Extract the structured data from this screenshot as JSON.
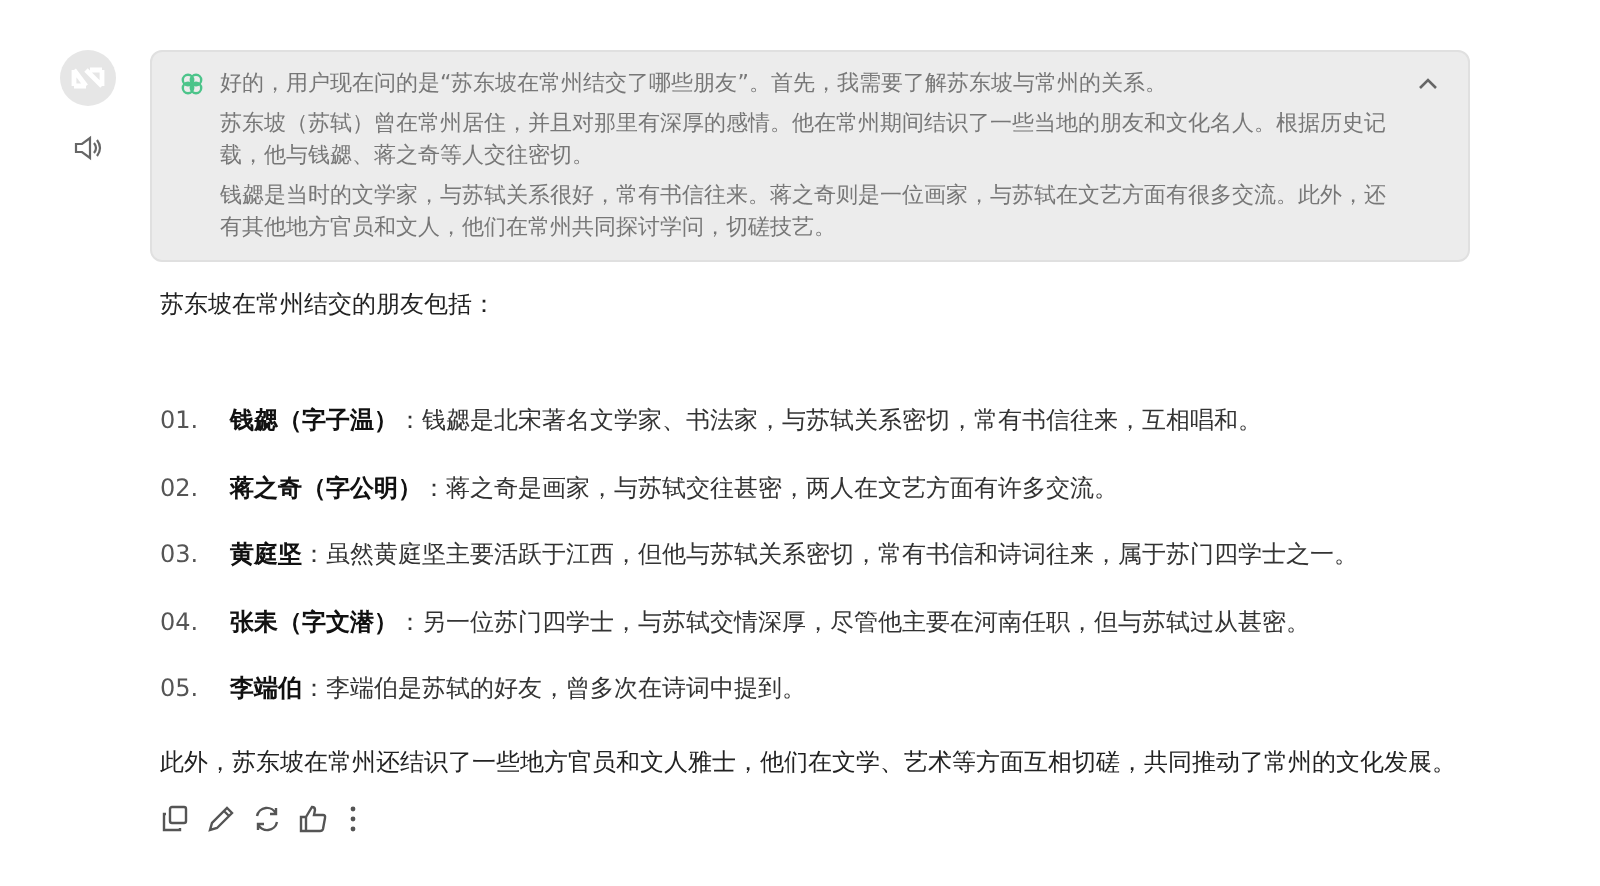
{
  "thinking": {
    "expanded": true,
    "paragraphs": [
      "好的，用户现在问的是“苏东坡在常州结交了哪些朋友”。首先，我需要了解苏东坡与常州的关系。",
      "苏东坡（苏轼）曾在常州居住，并且对那里有深厚的感情。他在常州期间结识了一些当地的朋友和文化名人。根据历史记载，他与钱勰、蒋之奇等人交往密切。",
      "钱勰是当时的文学家，与苏轼关系很好，常有书信往来。蒋之奇则是一位画家，与苏轼在文艺方面有很多交流。此外，还有其他地方官员和文人，他们在常州共同探讨学问，切磋技艺。"
    ]
  },
  "intro": "苏东坡在常州结交的朋友包括：",
  "friends": [
    {
      "number": "01.",
      "text": "**钱勰（字子温）**：钱勰是北宋著名文学家、书法家，与苏轼关系密切，常有书信往来，互相唱和。"
    },
    {
      "number": "02.",
      "text": "**蒋之奇（字公明）**：蒋之奇是画家，与苏轼交往甚密，两人在文艺方面有许多交流。"
    },
    {
      "number": "03.",
      "text": "**黄庭坚**：虽然黄庭坚主要活跃于江西，但他与苏轼关系密切，常有书信和诗词往来，属于苏门四学士之一。"
    },
    {
      "number": "04.",
      "text": "**张耒（字文潜）**：另一位苏门四学士，与苏轼交情深厚，尽管他主要在河南任职，但与苏轼过从甚密。"
    },
    {
      "number": "05.",
      "text": "**李端伯**：李端伯是苏轼的好友，曾多次在诗词中提到。"
    }
  ],
  "conclusion": "此外，苏东坡在常州还结识了一些地方官员和文人雅士，他们在文学、艺术等方面互相切磋，共同推动了常州的文化发展。"
}
